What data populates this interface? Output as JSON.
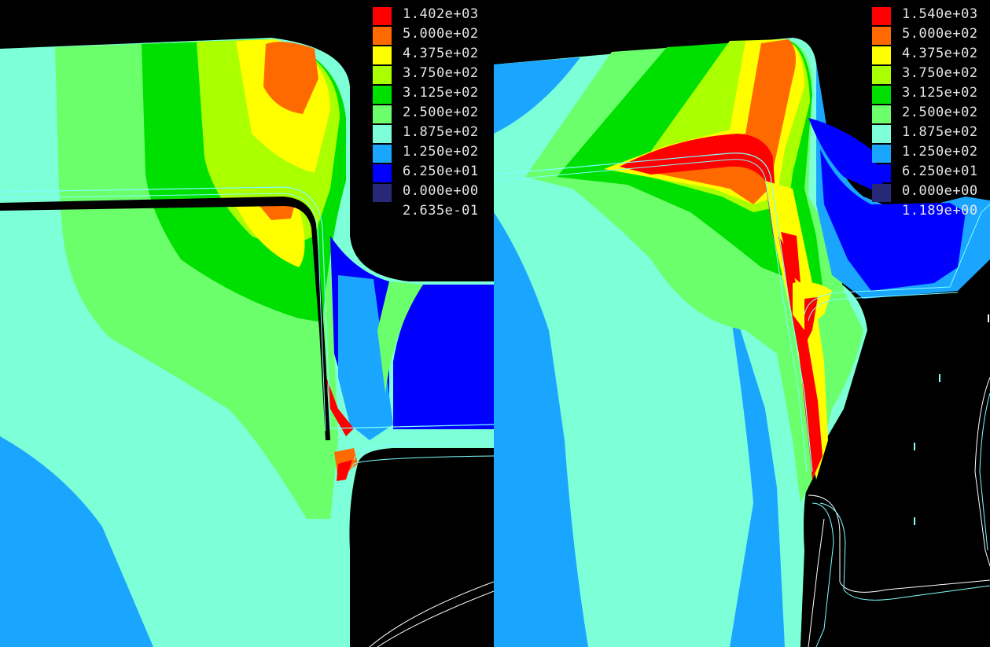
{
  "colors": {
    "background": "#000000",
    "outline": "#7fffff",
    "label_text": "#e6e6e6"
  },
  "palette": [
    {
      "name": "red",
      "hex": "#ff0000"
    },
    {
      "name": "orange",
      "hex": "#ff6a00"
    },
    {
      "name": "yellow",
      "hex": "#ffff00"
    },
    {
      "name": "yellow-green",
      "hex": "#aaff00"
    },
    {
      "name": "green",
      "hex": "#00e000"
    },
    {
      "name": "light-green",
      "hex": "#6cff6c"
    },
    {
      "name": "aquamarine",
      "hex": "#7dffd8"
    },
    {
      "name": "sky-blue",
      "hex": "#1aa6ff"
    },
    {
      "name": "blue",
      "hex": "#0000ff"
    },
    {
      "name": "navy",
      "hex": "#282878"
    }
  ],
  "panels": [
    {
      "id": "left",
      "legend": [
        "1.402e+03",
        "5.000e+02",
        "4.375e+02",
        "3.750e+02",
        "3.125e+02",
        "2.500e+02",
        "1.875e+02",
        "1.250e+02",
        "6.250e+01",
        "0.000e+00",
        "2.635e-01"
      ]
    },
    {
      "id": "right",
      "legend": [
        "1.540e+03",
        "5.000e+02",
        "4.375e+02",
        "3.750e+02",
        "3.125e+02",
        "2.500e+02",
        "1.875e+02",
        "1.250e+02",
        "6.250e+01",
        "0.000e+00",
        "1.189e+00"
      ]
    }
  ]
}
